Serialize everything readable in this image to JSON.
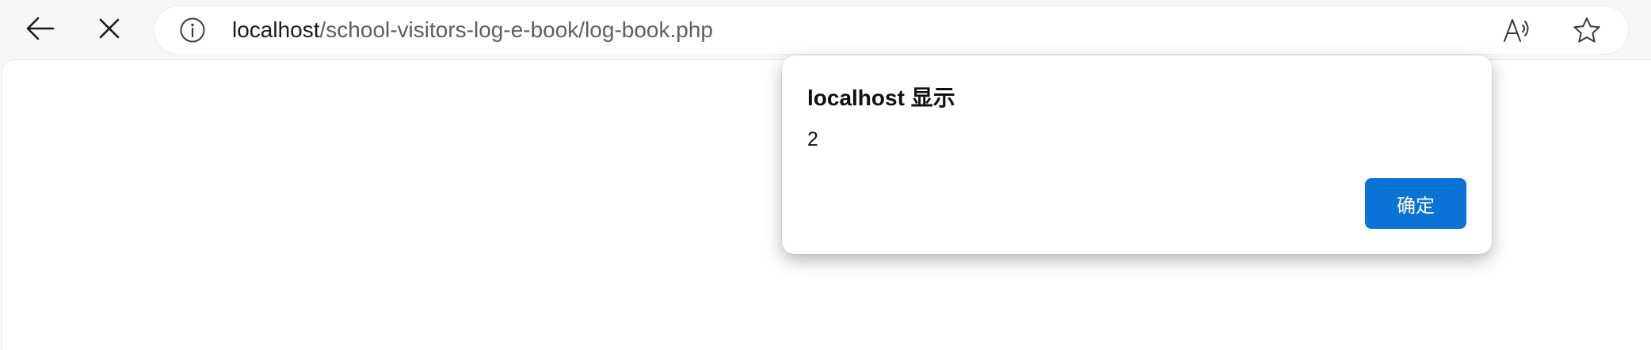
{
  "browser": {
    "url_host": "localhost",
    "url_path": "/school-visitors-log-e-book/log-book.php",
    "icons": {
      "back": "back-arrow-icon",
      "stop": "close-icon",
      "info": "info-icon",
      "read_aloud": "read-aloud-icon",
      "favorite": "star-icon"
    }
  },
  "dialog": {
    "title": "localhost 显示",
    "message": "2",
    "ok_label": "确定",
    "accent_color": "#0b73d6"
  }
}
